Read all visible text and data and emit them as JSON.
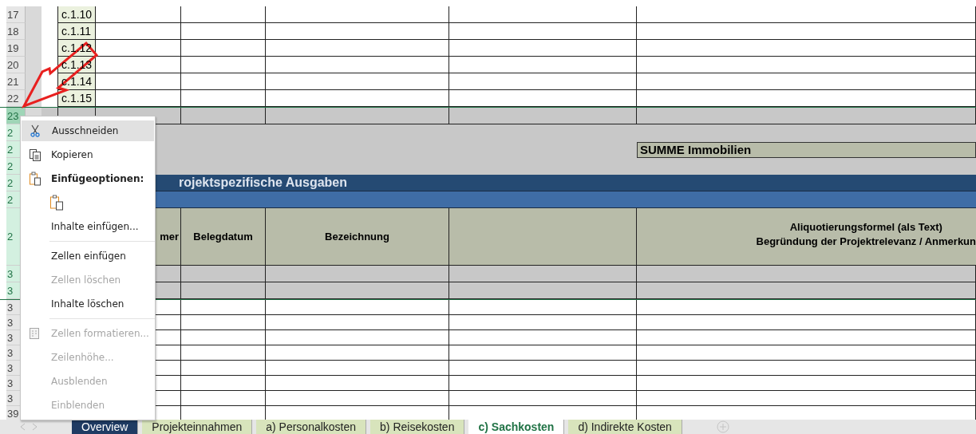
{
  "sheet": {
    "rows": [
      {
        "number": "17",
        "kind": "item",
        "selected": false,
        "active": false,
        "code": "c.1.10"
      },
      {
        "number": "18",
        "kind": "item",
        "selected": false,
        "active": false,
        "code": "c.1.11"
      },
      {
        "number": "19",
        "kind": "item",
        "selected": false,
        "active": false,
        "code": "c.1.12"
      },
      {
        "number": "20",
        "kind": "item",
        "selected": false,
        "active": false,
        "code": "c.1.13"
      },
      {
        "number": "21",
        "kind": "item",
        "selected": false,
        "active": false,
        "code": "c.1.14"
      },
      {
        "number": "22",
        "kind": "item",
        "selected": false,
        "active": false,
        "code": "c.1.15"
      },
      {
        "number": "23",
        "kind": "grey",
        "selected": true,
        "active": true
      },
      {
        "number": "2",
        "kind": "gap",
        "selected": true,
        "active": false
      },
      {
        "number": "2",
        "kind": "sum",
        "selected": true,
        "active": false,
        "label": "SUMME Immobilien"
      },
      {
        "number": "2",
        "kind": "gap",
        "selected": true,
        "active": false
      },
      {
        "number": "2",
        "kind": "title",
        "selected": true,
        "active": false,
        "title": "rojektspezifische Ausgaben"
      },
      {
        "number": "2",
        "kind": "band",
        "selected": true,
        "active": false
      },
      {
        "number": "2",
        "kind": "header",
        "selected": true,
        "active": false,
        "cells": [
          "mer",
          "Belegdatum",
          "Bezeichnung"
        ],
        "note_lines": [
          "Aliquotierungsformel (als Text)",
          "Begründung der Projektrelevanz / Anmerkun"
        ]
      },
      {
        "number": "3",
        "kind": "grey",
        "selected": true,
        "active": false
      },
      {
        "number": "3",
        "kind": "grey",
        "selected": true,
        "active": false
      },
      {
        "number": "3",
        "kind": "blank",
        "selected": false,
        "active": false
      },
      {
        "number": "3",
        "kind": "blank",
        "selected": false,
        "active": false
      },
      {
        "number": "3",
        "kind": "blank",
        "selected": false,
        "active": false
      },
      {
        "number": "3",
        "kind": "blank",
        "selected": false,
        "active": false
      },
      {
        "number": "3",
        "kind": "blank",
        "selected": false,
        "active": false
      },
      {
        "number": "3",
        "kind": "blank",
        "selected": false,
        "active": false
      },
      {
        "number": "3",
        "kind": "blank",
        "selected": false,
        "active": false
      },
      {
        "number": "39",
        "kind": "blank",
        "selected": false,
        "active": false
      }
    ]
  },
  "context_menu": {
    "items": [
      {
        "kind": "cut",
        "label": "Ausschneiden",
        "highlighted": true,
        "disabled": false
      },
      {
        "kind": "copy",
        "label": "Kopieren",
        "highlighted": false,
        "disabled": false
      },
      {
        "kind": "header",
        "label": "Einfügeoptionen:"
      },
      {
        "kind": "paste"
      },
      {
        "kind": "command",
        "label": "Inhalte einfügen...",
        "highlighted": false,
        "disabled": false
      },
      {
        "kind": "separator"
      },
      {
        "kind": "command",
        "label": "Zellen einfügen",
        "highlighted": false,
        "disabled": false
      },
      {
        "kind": "command",
        "label": "Zellen löschen",
        "highlighted": false,
        "disabled": true
      },
      {
        "kind": "command",
        "label": "Inhalte löschen",
        "highlighted": false,
        "disabled": false
      },
      {
        "kind": "separator"
      },
      {
        "kind": "format",
        "label": "Zellen formatieren...",
        "highlighted": false,
        "disabled": true
      },
      {
        "kind": "command",
        "label": "Zeilenhöhe...",
        "highlighted": false,
        "disabled": true
      },
      {
        "kind": "command",
        "label": "Ausblenden",
        "highlighted": false,
        "disabled": true
      },
      {
        "kind": "command",
        "label": "Einblenden",
        "highlighted": false,
        "disabled": true
      }
    ]
  },
  "sheet_tabs": [
    {
      "label": "Overview",
      "selected": false,
      "color": "#1f3b63"
    },
    {
      "label": "Projekteinnahmen",
      "selected": false,
      "color": "#d8e4bc"
    },
    {
      "label": "a) Personalkosten",
      "selected": false,
      "color": "#d8e4bc"
    },
    {
      "label": "b) Reisekosten",
      "selected": false,
      "color": "#d8e4bc"
    },
    {
      "label": "c) Sachkosten",
      "selected": true
    },
    {
      "label": "d) Indirekte Kosten",
      "selected": false,
      "color": "#d8e4bc"
    }
  ]
}
